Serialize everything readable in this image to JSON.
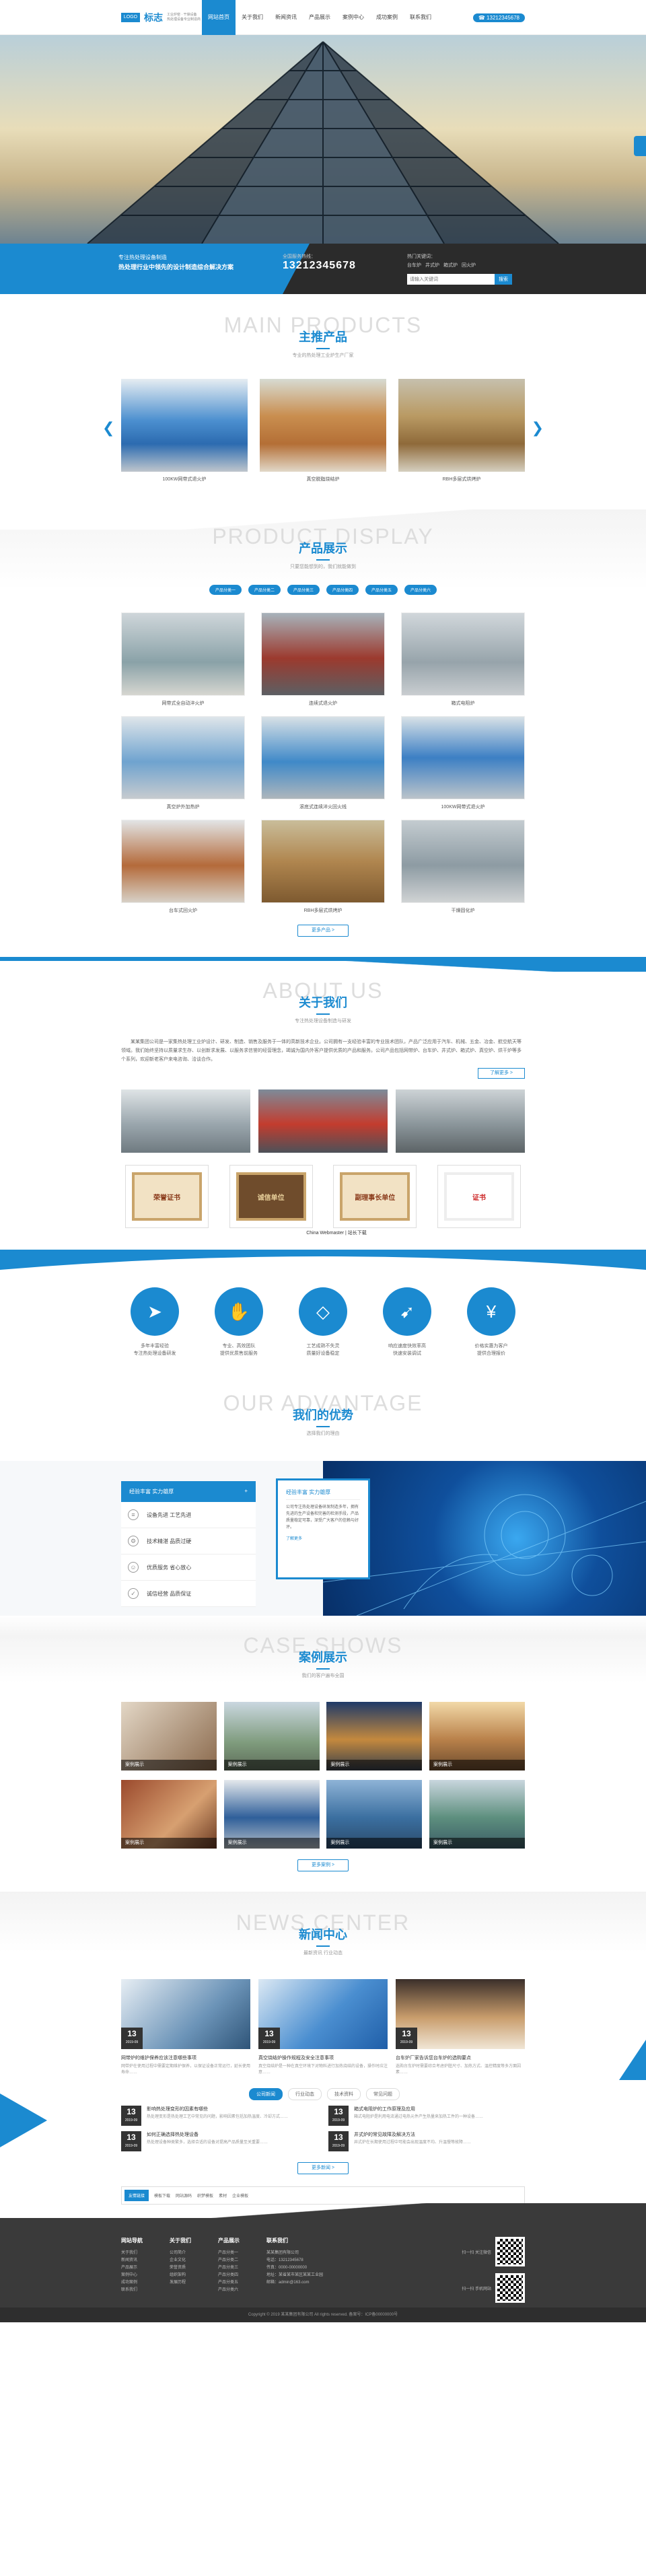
{
  "header": {
    "logo_mark": "LOGO",
    "logo_text": "标志",
    "logo_sub1": "工业炉窑 · 干燥设备",
    "logo_sub2": "热处理设备专业制造商",
    "nav": [
      "网站首页",
      "关于我们",
      "新闻资讯",
      "产品展示",
      "案例中心",
      "成功案例",
      "联系我们"
    ],
    "tel": "13212345678"
  },
  "info": {
    "line1": "专注热处理设备制造",
    "line2": "热处理行业中领先的设计制造综合解决方案",
    "tel_label": "全国服务热线：",
    "tel": "13212345678",
    "kw_label": "热门关键词：",
    "keywords": [
      "台车炉",
      "井式炉",
      "箱式炉",
      "回火炉"
    ],
    "search_placeholder": "请输入关键词",
    "search_btn": "搜索"
  },
  "main_products": {
    "en": "MAIN PRODUCTS",
    "zh": "主推产品",
    "sub": "专业的热处理工业炉生产厂家",
    "items": [
      "100KW网带式退火炉",
      "真空脱脂烧结炉",
      "RBH多层式烘烤炉"
    ]
  },
  "product_display": {
    "en": "PRODUCT DISPLAY",
    "zh": "产品展示",
    "sub": "只要您能想到的，我们就能做到",
    "tabs": [
      "产品分类一",
      "产品分类二",
      "产品分类三",
      "产品分类四",
      "产品分类五",
      "产品分类六"
    ],
    "items": [
      "网带式全自动淬火炉",
      "连续式退火炉",
      "箱式电阻炉",
      "真空炉外加热炉",
      "滚底式连续淬火回火线",
      "100KW网带式退火炉",
      "台车式回火炉",
      "RBH多层式烘烤炉",
      "干燥固化炉"
    ],
    "more": "更多产品 >"
  },
  "about": {
    "en": "ABOUT US",
    "zh": "关于我们",
    "sub": "专注热处理设备制造与研发",
    "text": "某某集团公司是一家集热处理工业炉设计、研发、制造、销售及服务于一体的高新技术企业。公司拥有一支经验丰富的专业技术团队，产品广泛应用于汽车、机械、五金、冶金、航空航天等领域。我们始终坚持以质量求生存、以创新求发展、以服务求信誉的经营理念，竭诚为国内外客户提供优质的产品和服务。公司产品包括网带炉、台车炉、井式炉、箱式炉、真空炉、烘干炉等多个系列，欢迎新老客户来电咨询、洽谈合作。",
    "more": "了解更多 >",
    "certs": [
      "荣誉证书",
      "诚信单位",
      "副理事长单位",
      "证书"
    ],
    "watermark": "China Webmaster | 站长下载"
  },
  "services": [
    {
      "icon": "paper-plane",
      "t1": "多年丰富经验",
      "t2": "专注热处理设备研发"
    },
    {
      "icon": "handshake",
      "t1": "专业、高效团队",
      "t2": "提供优质售前服务"
    },
    {
      "icon": "diamond",
      "t1": "工艺成熟不失灵",
      "t2": "质量好设备稳定"
    },
    {
      "icon": "rocket",
      "t1": "响应速度快效率高",
      "t2": "快速安装调试"
    },
    {
      "icon": "yen",
      "t1": "价格实惠为客户",
      "t2": "提供合理报价"
    }
  ],
  "advantage": {
    "en": "OUR ADVANTAGE",
    "zh": "我们的优势",
    "sub": "选择我们的理由",
    "menu_head": "经验丰富 实力雄厚",
    "menu": [
      "设备先进 工艺先进",
      "技术精湛 品质过硬",
      "优质服务 省心放心",
      "诚信经营 品质保证"
    ],
    "card_title": "经验丰富 实力雄厚",
    "card_text": "公司专注热处理设备研发制造多年，拥有先进的生产设备和完善的检测手段，产品质量稳定可靠，深受广大客户的信赖与好评。",
    "card_more": "了解更多"
  },
  "cases": {
    "en": "CASE SHOWS",
    "zh": "案例展示",
    "sub": "我们的客户遍布全国",
    "items": [
      "案例展示",
      "案例展示",
      "案例展示",
      "案例展示",
      "案例展示",
      "案例展示",
      "案例展示",
      "案例展示"
    ],
    "more": "更多案例 >"
  },
  "news": {
    "en": "NEWS CENTER",
    "zh": "新闻中心",
    "sub": "最新资讯 行业动态",
    "top": [
      {
        "day": "13",
        "ym": "2019-09",
        "title": "网带炉的维护保养应该注意哪些事项",
        "desc": "网带炉在使用过程中需要定期维护保养，以保证设备正常运行，延长使用寿命……"
      },
      {
        "day": "13",
        "ym": "2019-09",
        "title": "真空烧结炉操作规程及安全注意事项",
        "desc": "真空烧结炉是一种在真空环境下对物料进行加热烧结的设备，操作时应注意……"
      },
      {
        "day": "13",
        "ym": "2019-09",
        "title": "台车炉厂家告诉您台车炉的选购要点",
        "desc": "选购台车炉时需要综合考虑炉膛尺寸、加热方式、温控精度等多方面因素……"
      }
    ],
    "tabs": [
      "公司新闻",
      "行业动态",
      "技术资料",
      "常见问题"
    ],
    "list": [
      {
        "day": "13",
        "ym": "2019-09",
        "title": "影响热处理变形的因素有哪些",
        "desc": "热处理变形是热处理工艺中常见的问题，影响因素包括加热温度、冷却方式……"
      },
      {
        "day": "13",
        "ym": "2019-09",
        "title": "箱式电阻炉的工作原理及应用",
        "desc": "箱式电阻炉是利用电流通过电热元件产生热量来加热工件的一种设备……"
      },
      {
        "day": "13",
        "ym": "2019-09",
        "title": "如何正确选择热处理设备",
        "desc": "热处理设备种类繁多，选择合适的设备对提高产品质量至关重要……"
      },
      {
        "day": "13",
        "ym": "2019-09",
        "title": "井式炉的常见故障及解决方法",
        "desc": "井式炉在长期使用过程中可能会出现温度不均、升温慢等故障……"
      }
    ],
    "more": "更多新闻 >",
    "links_label": "友情链接",
    "links": [
      "模板下载",
      "网站源码",
      "织梦模板",
      "素材",
      "企业模板"
    ]
  },
  "footer": {
    "cols": [
      {
        "h": "网站导航",
        "items": [
          "关于我们",
          "新闻资讯",
          "产品展示",
          "案例中心",
          "成功案例",
          "联系我们"
        ]
      },
      {
        "h": "关于我们",
        "items": [
          "公司简介",
          "企业文化",
          "荣誉资质",
          "组织架构",
          "发展历程"
        ]
      },
      {
        "h": "产品展示",
        "items": [
          "产品分类一",
          "产品分类二",
          "产品分类三",
          "产品分类四",
          "产品分类五",
          "产品分类六"
        ]
      },
      {
        "h": "联系我们",
        "items": [
          "某某集团有限公司",
          "电话：13212345678",
          "传真：0000-00000000",
          "地址：某省某市某区某某工业园",
          "邮箱：admin@163.com"
        ]
      }
    ],
    "qr1": "扫一扫 关注微信",
    "qr2": "扫一扫 手机网站",
    "copyright": "Copyright © 2019 某某集团有限公司 All rights reserved. 备案号：ICP备00000000号"
  }
}
